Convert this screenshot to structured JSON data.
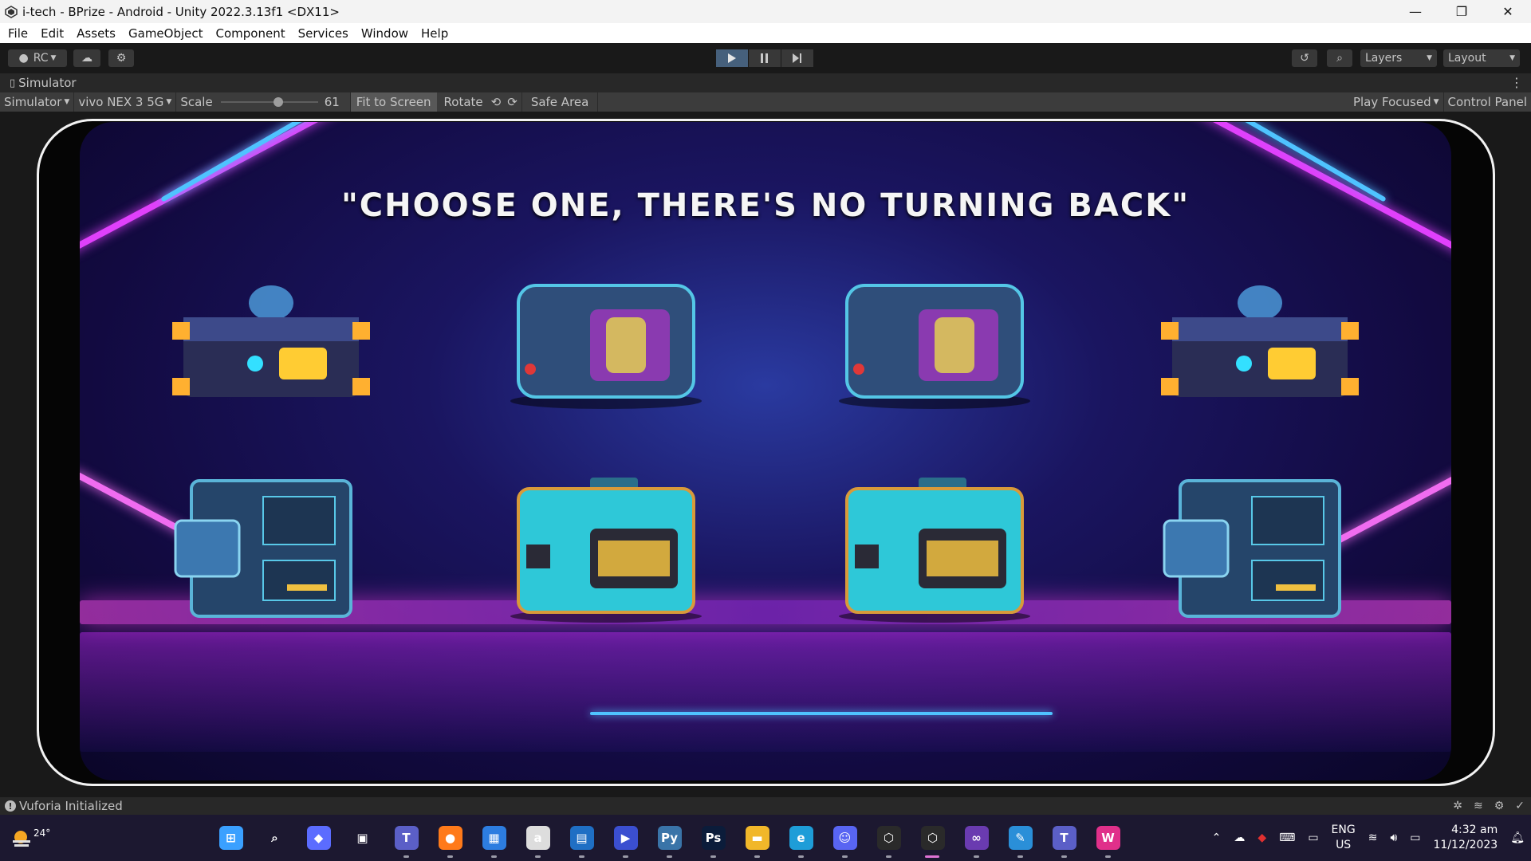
{
  "window": {
    "title": "i-tech - BPrize - Android - Unity 2022.3.13f1 <DX11>"
  },
  "menu": [
    "File",
    "Edit",
    "Assets",
    "GameObject",
    "Component",
    "Services",
    "Window",
    "Help"
  ],
  "toolbar": {
    "account_label": "RC",
    "layers_label": "Layers",
    "layout_label": "Layout"
  },
  "tab": {
    "label": "Simulator"
  },
  "simbar": {
    "mode": "Simulator",
    "device": "vivo NEX 3 5G",
    "scale_label": "Scale",
    "scale_value": "61",
    "fit_label": "Fit to Screen",
    "rotate_label": "Rotate",
    "safe_area_label": "Safe Area",
    "play_focused_label": "Play Focused",
    "control_panel_label": "Control Panel"
  },
  "game": {
    "headline": "\"CHOOSE ONE, THERE'S NO TURNING BACK\"",
    "boxes": [
      {
        "kind": "drone-crate"
      },
      {
        "kind": "capsule-crate"
      },
      {
        "kind": "capsule-crate"
      },
      {
        "kind": "drone-crate"
      },
      {
        "kind": "tech-crate"
      },
      {
        "kind": "cyan-crate"
      },
      {
        "kind": "cyan-crate"
      },
      {
        "kind": "tech-crate"
      }
    ]
  },
  "status": {
    "message": "Vuforia Initialized"
  },
  "taskbar": {
    "temperature": "24°",
    "language": "ENG",
    "region": "US",
    "time": "4:32 am",
    "date": "11/12/2023",
    "apps": [
      {
        "name": "windows-start-icon",
        "glyph": "⊞",
        "color": "#3aa0ff"
      },
      {
        "name": "search-icon",
        "glyph": "⌕",
        "color": "transparent"
      },
      {
        "name": "copilot-icon",
        "glyph": "◆",
        "color": "#5b6cff"
      },
      {
        "name": "task-view-icon",
        "glyph": "▣",
        "color": "transparent"
      },
      {
        "name": "teams-icon",
        "glyph": "T",
        "color": "#5b5fc7"
      },
      {
        "name": "firefox-icon",
        "glyph": "●",
        "color": "#ff7a1a"
      },
      {
        "name": "store-icon",
        "glyph": "▦",
        "color": "#2d7de0"
      },
      {
        "name": "amazon-icon",
        "glyph": "a",
        "color": "#dddddd"
      },
      {
        "name": "news-icon",
        "glyph": "▤",
        "color": "#1f6fc4"
      },
      {
        "name": "media-icon",
        "glyph": "▶",
        "color": "#3b4fd0"
      },
      {
        "name": "python-icon",
        "glyph": "Py",
        "color": "#3a74a8"
      },
      {
        "name": "photoshop-icon",
        "glyph": "Ps",
        "color": "#0b1c3a"
      },
      {
        "name": "file-explorer-icon",
        "glyph": "▬",
        "color": "#f1b72a"
      },
      {
        "name": "edge-icon",
        "glyph": "e",
        "color": "#1e9dd8"
      },
      {
        "name": "discord-icon",
        "glyph": "☺",
        "color": "#5865f2"
      },
      {
        "name": "unity-hub-icon",
        "glyph": "⬡",
        "color": "#2a2a2a"
      },
      {
        "name": "unity-icon",
        "glyph": "⬡",
        "color": "#2a2a2a"
      },
      {
        "name": "visual-studio-icon",
        "glyph": "∞",
        "color": "#6a3bb0"
      },
      {
        "name": "paint-icon",
        "glyph": "✎",
        "color": "#2a8fd8"
      },
      {
        "name": "teams-chat-icon",
        "glyph": "T",
        "color": "#5b5fc7"
      },
      {
        "name": "w-app-icon",
        "glyph": "W",
        "color": "#e0308a"
      }
    ]
  }
}
